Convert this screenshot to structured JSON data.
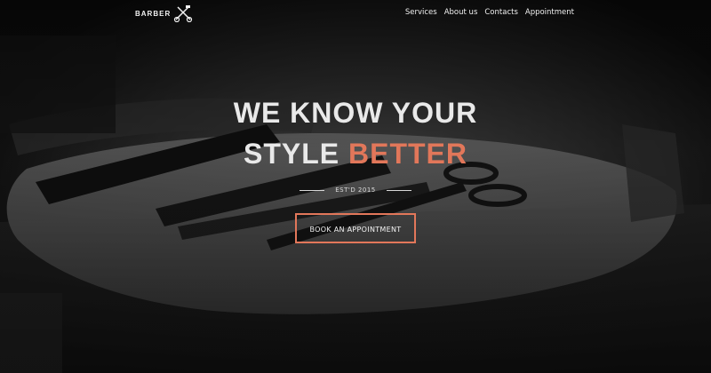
{
  "brand": {
    "name": "BARBER",
    "logo_icon": "scissors-razor-icon"
  },
  "nav": {
    "items": [
      {
        "label": "Services"
      },
      {
        "label": "About us"
      },
      {
        "label": "Contacts"
      },
      {
        "label": "Appointment"
      }
    ]
  },
  "hero": {
    "headline_line1": "WE KNOW YOUR",
    "headline_line2_prefix": "STYLE",
    "headline_line2_accent": "BETTER",
    "established": "EST'D 2015",
    "cta_label": "BOOK AN APPOINTMENT"
  },
  "colors": {
    "accent": "#e2775a",
    "text": "#e9e9e9",
    "background": "#0b0b0b"
  }
}
